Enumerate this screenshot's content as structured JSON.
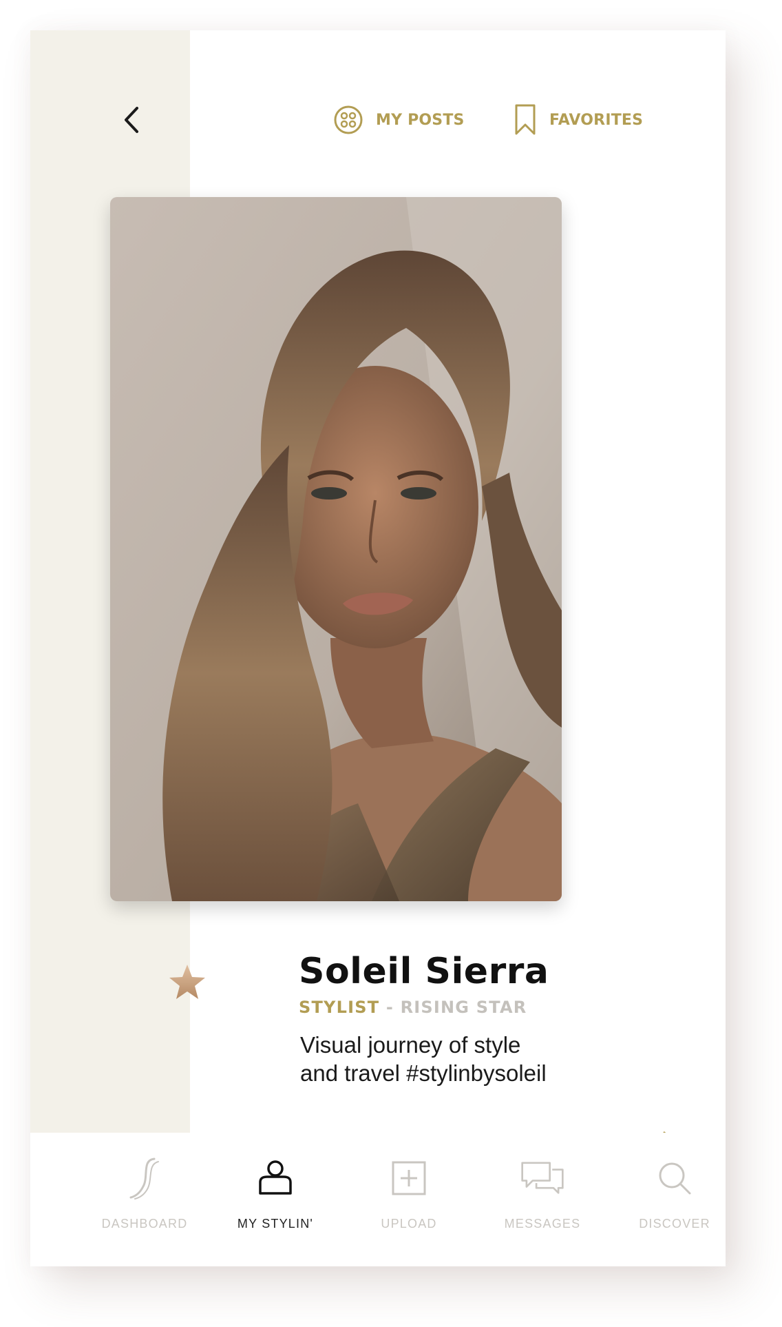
{
  "header": {
    "back_icon": "chevron-left-icon",
    "my_posts_label": "MY POSTS",
    "my_posts_icon": "grid-circle-icon",
    "favorites_label": "FAVORITES",
    "favorites_icon": "bookmark-icon"
  },
  "profile": {
    "photo": "portrait-photo",
    "name": "Soleil Sierra",
    "role_primary": "STYLIST",
    "role_secondary": " - RISING STAR",
    "bio_line1": "Visual journey of style",
    "bio_line2": "and travel #stylinbysoleil",
    "badge_icon": "star-icon",
    "next_icon": "arrow-right-icon"
  },
  "tabbar": {
    "tabs": [
      {
        "label": "DASHBOARD",
        "icon": "swoosh-icon",
        "active": false
      },
      {
        "label": "MY STYLIN'",
        "icon": "user-icon",
        "active": true
      },
      {
        "label": "UPLOAD",
        "icon": "plus-square-icon",
        "active": false
      },
      {
        "label": "MESSAGES",
        "icon": "chat-bubbles-icon",
        "active": false
      },
      {
        "label": "DISCOVER",
        "icon": "search-icon",
        "active": false
      }
    ]
  },
  "colors": {
    "accent_gold": "#b29d53",
    "side_panel": "#f3f1e9",
    "inactive": "#c9c6c1",
    "text": "#111111"
  }
}
